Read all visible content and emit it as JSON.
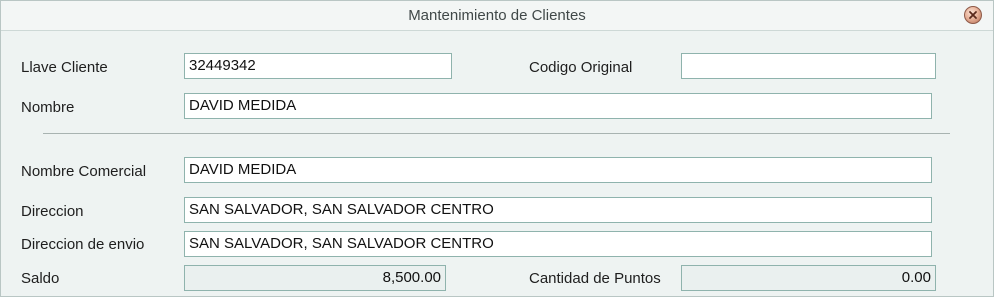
{
  "window": {
    "title": "Mantenimiento de Clientes"
  },
  "form": {
    "llave_cliente": {
      "label": "Llave Cliente",
      "value": "32449342"
    },
    "codigo_original": {
      "label": "Codigo Original",
      "value": ""
    },
    "nombre": {
      "label": "Nombre",
      "value": "DAVID MEDIDA"
    },
    "nombre_comercial": {
      "label": "Nombre Comercial",
      "value": "DAVID MEDIDA"
    },
    "direccion": {
      "label": "Direccion",
      "value": "SAN SALVADOR, SAN SALVADOR CENTRO"
    },
    "direccion_envio": {
      "label": "Direccion de envio",
      "value": "SAN SALVADOR, SAN SALVADOR CENTRO"
    },
    "saldo": {
      "label": "Saldo",
      "value": "8,500.00"
    },
    "cantidad_puntos": {
      "label": "Cantidad de Puntos",
      "value": "0.00"
    }
  },
  "icons": {
    "close": "close-icon"
  },
  "colors": {
    "background": "#eef3f2",
    "field_border": "#8fb3ad",
    "readonly_field": "#eaf0ef"
  }
}
